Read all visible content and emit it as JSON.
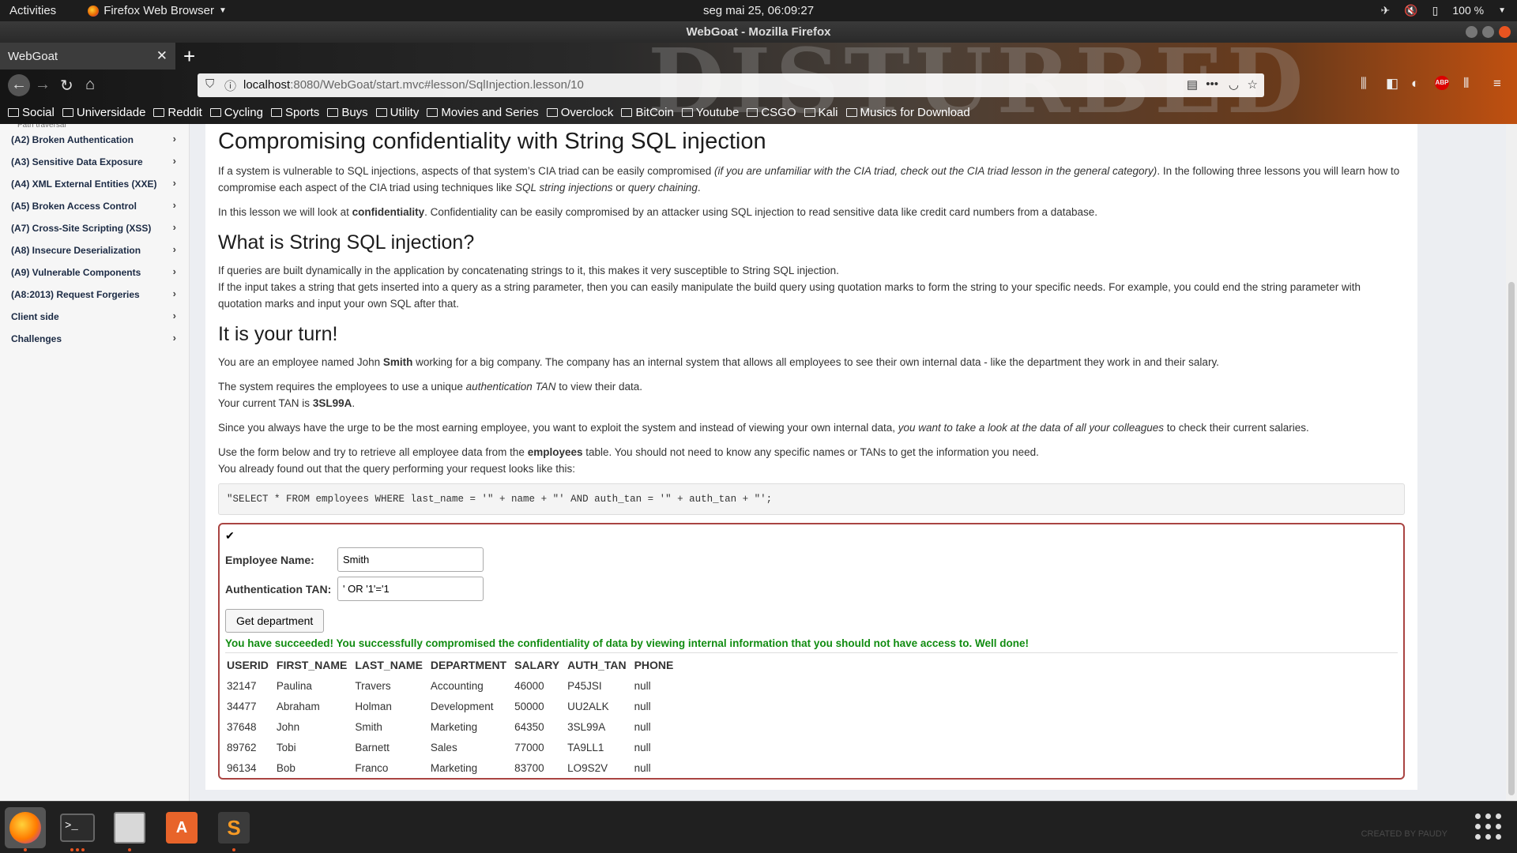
{
  "topbar": {
    "activities": "Activities",
    "app_name": "Firefox Web Browser",
    "clock": "seg mai 25, 06:09:27",
    "battery": "100 %"
  },
  "window": {
    "title": "WebGoat - Mozilla Firefox"
  },
  "browser": {
    "tab_title": "WebGoat",
    "banner_text": "DISTURBED",
    "url_host": "localhost",
    "url_rest": ":8080/WebGoat/start.mvc#lesson/SqlInjection.lesson/10",
    "bookmarks": [
      "Social",
      "Universidade",
      "Reddit",
      "Cycling",
      "Sports",
      "Buys",
      "Utility",
      "Movies and Series",
      "Overclock",
      "BitCoin",
      "Youtube",
      "CSGO",
      "Kali",
      "Musics for Download"
    ]
  },
  "sidebar": {
    "cut_item": "Path traversal",
    "items": [
      {
        "label": "(A2) Broken Authentication"
      },
      {
        "label": "(A3) Sensitive Data Exposure"
      },
      {
        "label": "(A4) XML External Entities (XXE)"
      },
      {
        "label": "(A5) Broken Access Control"
      },
      {
        "label": "(A7) Cross-Site Scripting (XSS)"
      },
      {
        "label": "(A8) Insecure Deserialization"
      },
      {
        "label": "(A9) Vulnerable Components"
      },
      {
        "label": "(A8:2013) Request Forgeries"
      },
      {
        "label": "Client side"
      },
      {
        "label": "Challenges"
      }
    ]
  },
  "lesson": {
    "title": "Compromising confidentiality with String SQL injection",
    "p1_a": "If a system is vulnerable to SQL injections, aspects of that system’s CIA triad can be easily compromised ",
    "p1_b": "(if you are unfamiliar with the CIA triad, check out the CIA triad lesson in the general category)",
    "p1_c": ". In the following three lessons you will learn how to compromise each aspect of the CIA triad using techniques like ",
    "p1_d": "SQL string injections",
    "p1_e": " or ",
    "p1_f": "query chaining",
    "p1_g": ".",
    "p2_a": "In this lesson we will look at ",
    "p2_b": "confidentiality",
    "p2_c": ". Confidentiality can be easily compromised by an attacker using SQL injection to read sensitive data like credit card numbers from a database.",
    "h2_1": "What is String SQL injection?",
    "p3_1": "If queries are built dynamically in the application by concatenating strings to it, this makes it very susceptible to String SQL injection.",
    "p3_2": "If the input takes a string that gets inserted into a query as a string parameter, then you can easily manipulate the build query using quotation marks to form the string to your specific needs. For example, you could end the string parameter with quotation marks and input your own SQL after that.",
    "h2_2": "It is your turn!",
    "p4_a": "You are an employee named John ",
    "p4_b": "Smith",
    "p4_c": " working for a big company. The company has an internal system that allows all employees to see their own internal data - like the department they work in and their salary.",
    "p5_a": "The system requires the employees to use a unique ",
    "p5_b": "authentication TAN",
    "p5_c": " to view their data.",
    "p5_d": "Your current TAN is ",
    "p5_e": "3SL99A",
    "p5_f": ".",
    "p6_a": "Since you always have the urge to be the most earning employee, you want to exploit the system and instead of viewing your own internal data, ",
    "p6_b": "you want to take a look at the data of all your colleagues",
    "p6_c": " to check their current salaries.",
    "p7_a": "Use the form below and try to retrieve all employee data from the ",
    "p7_b": "employees",
    "p7_c": " table. You should not need to know any specific names or TANs to get the information you need.",
    "p7_d": "You already found out that the query performing your request looks like this:",
    "query": "\"SELECT * FROM employees WHERE last_name = '\" + name + \"' AND auth_tan = '\" + auth_tan + \"';"
  },
  "form": {
    "name_label": "Employee Name:",
    "name_value": "Smith",
    "tan_label": "Authentication TAN:",
    "tan_value": "' OR '1'='1",
    "submit_label": "Get department"
  },
  "result": {
    "success": "You have succeeded! You successfully compromised the confidentiality of data by viewing internal information that you should not have access to. Well done!",
    "columns": [
      "USERID",
      "FIRST_NAME",
      "LAST_NAME",
      "DEPARTMENT",
      "SALARY",
      "AUTH_TAN",
      "PHONE"
    ],
    "rows": [
      [
        "32147",
        "Paulina",
        "Travers",
        "Accounting",
        "46000",
        "P45JSI",
        "null"
      ],
      [
        "34477",
        "Abraham",
        "Holman",
        "Development",
        "50000",
        "UU2ALK",
        "null"
      ],
      [
        "37648",
        "John",
        "Smith",
        "Marketing",
        "64350",
        "3SL99A",
        "null"
      ],
      [
        "89762",
        "Tobi",
        "Barnett",
        "Sales",
        "77000",
        "TA9LL1",
        "null"
      ],
      [
        "96134",
        "Bob",
        "Franco",
        "Marketing",
        "83700",
        "LO9S2V",
        "null"
      ]
    ]
  },
  "dock": {
    "watermark": "CREATED BY PAUDY"
  }
}
